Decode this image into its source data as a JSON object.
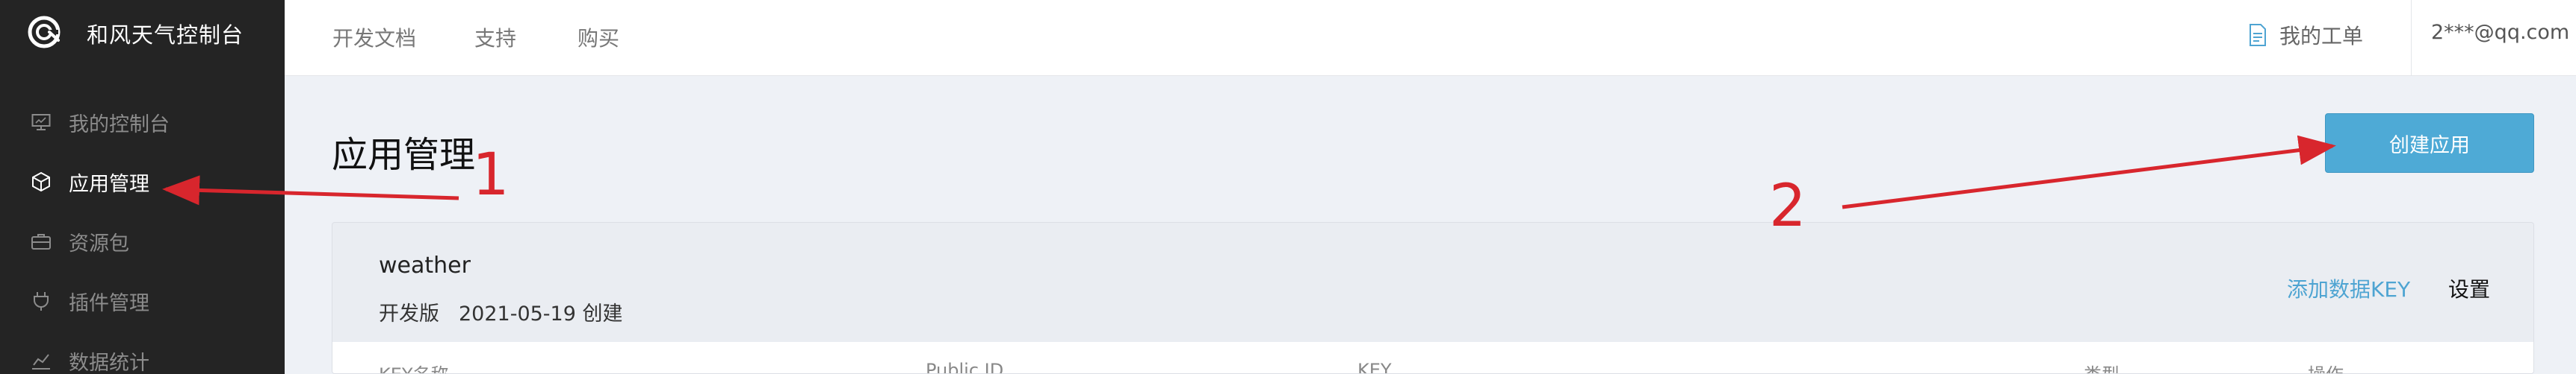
{
  "sidebar": {
    "brand": "和风天气控制台",
    "items": [
      {
        "label": "我的控制台",
        "icon": "monitor-icon"
      },
      {
        "label": "应用管理",
        "icon": "cube-icon"
      },
      {
        "label": "资源包",
        "icon": "briefcase-icon"
      },
      {
        "label": "插件管理",
        "icon": "plug-icon"
      },
      {
        "label": "数据统计",
        "icon": "stats-icon"
      }
    ]
  },
  "topbar": {
    "nav": [
      "开发文档",
      "支持",
      "购买"
    ],
    "ticket": "我的工单",
    "account": "2***@qq.com"
  },
  "main": {
    "title": "应用管理",
    "create_button": "创建应用",
    "app": {
      "name": "weather",
      "plan": "开发版",
      "created": "2021-05-19 创建",
      "add_key": "添加数据KEY",
      "settings": "设置"
    },
    "table_headers": [
      "KEY名称",
      "Public ID",
      "KEY",
      "类型",
      "操作"
    ]
  },
  "annotations": [
    "1",
    "2"
  ],
  "colors": {
    "sidebar_bg": "#242424",
    "accent": "#4eaad6",
    "annotation": "#d8262d"
  }
}
